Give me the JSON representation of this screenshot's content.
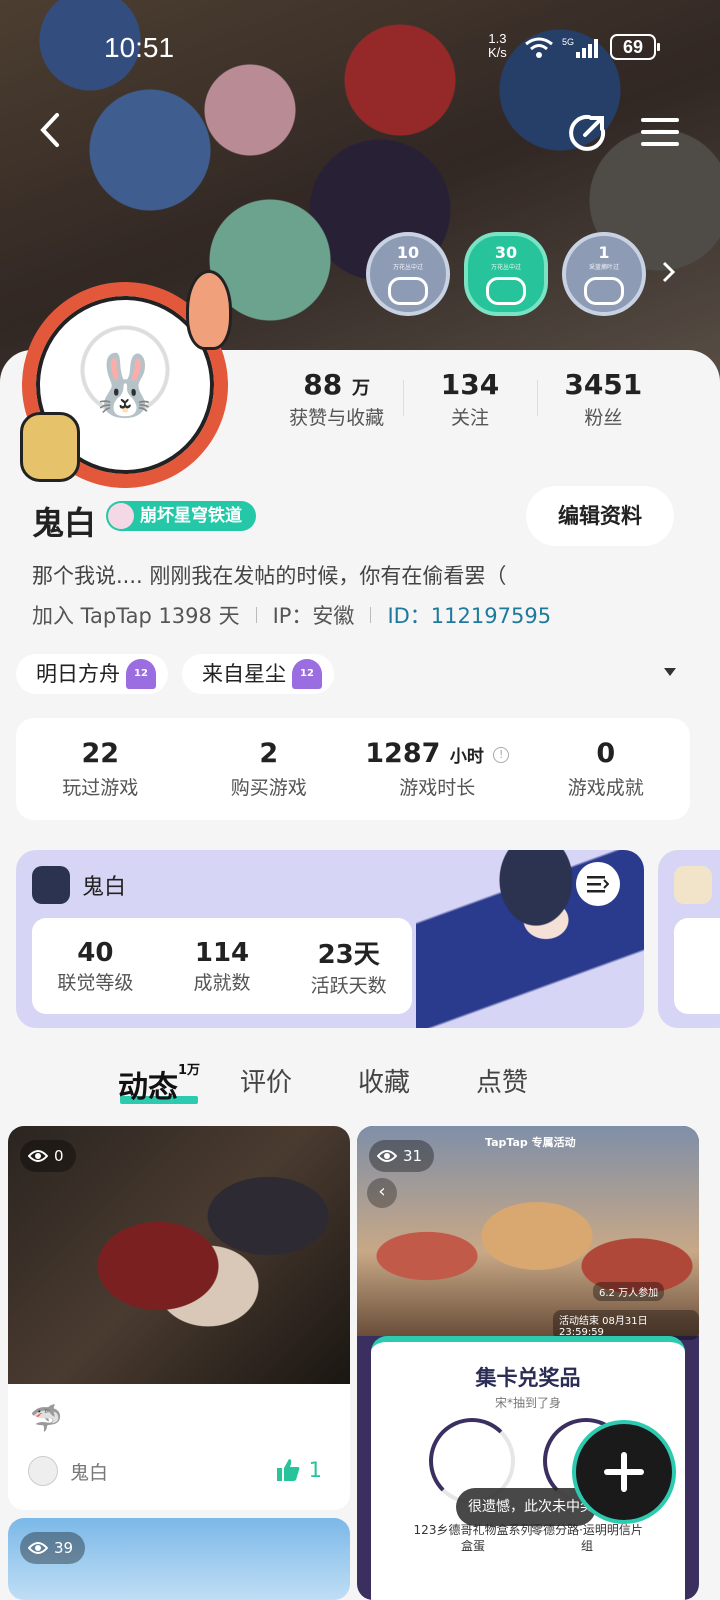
{
  "status_bar": {
    "time": "10:51",
    "net_speed_value": "1.3",
    "net_speed_unit": "K/s",
    "network": "5G",
    "battery": "69"
  },
  "header": {
    "badges": [
      {
        "num": "10",
        "sub": "万花丛中过"
      },
      {
        "num": "30",
        "sub": "万花丛中过"
      },
      {
        "num": "1",
        "sub": "采蓝摘叶过"
      }
    ]
  },
  "profile": {
    "stats": [
      {
        "value": "88",
        "unit": "万",
        "label": "获赞与收藏"
      },
      {
        "value": "134",
        "unit": "",
        "label": "关注"
      },
      {
        "value": "3451",
        "unit": "",
        "label": "粉丝"
      }
    ],
    "name": "鬼白",
    "game_tag": "崩坏星穹铁道",
    "edit_label": "编辑资料",
    "bio": "那个我说.... 刚刚我在发帖的时候，你有在偷看罢（",
    "joined": "加入 TapTap 1398 天",
    "ip": "IP：安徽",
    "id": "ID：112197595",
    "chips": [
      {
        "label": "明日方舟",
        "level": "12"
      },
      {
        "label": "来自星尘",
        "level": "12"
      }
    ]
  },
  "game_stats": [
    {
      "value": "22",
      "unit": "",
      "label": "玩过游戏"
    },
    {
      "value": "2",
      "unit": "",
      "label": "购买游戏"
    },
    {
      "value": "1287",
      "unit": "小时",
      "label": "游戏时长"
    },
    {
      "value": "0",
      "unit": "",
      "label": "游戏成就"
    }
  ],
  "game_card": {
    "player": "鬼白",
    "items": [
      {
        "value": "40",
        "label": "联觉等级"
      },
      {
        "value": "114",
        "label": "成就数"
      },
      {
        "value": "23天",
        "label": "活跃天数"
      }
    ]
  },
  "tabs": [
    {
      "label": "动态",
      "count": "1万"
    },
    {
      "label": "评价",
      "count": ""
    },
    {
      "label": "收藏",
      "count": ""
    },
    {
      "label": "点赞",
      "count": ""
    }
  ],
  "posts": [
    {
      "views": "0",
      "emoji": "🦈",
      "author": "鬼白",
      "likes": "1"
    },
    {
      "views": "31",
      "header": "TapTap 专属活动",
      "participants": "6.2 万人参加",
      "ends": "活动结束 08月31日 23:59:59",
      "prize_title": "集卡兑奖品",
      "prize_sub": "宋*抽到了身",
      "prize_left": "123乡德哥礼物盒系列盒蛋",
      "prize_right": "零德分路·运明明信片组"
    },
    {
      "views": "39"
    }
  ],
  "toast": "很遗憾，此次未中奖"
}
